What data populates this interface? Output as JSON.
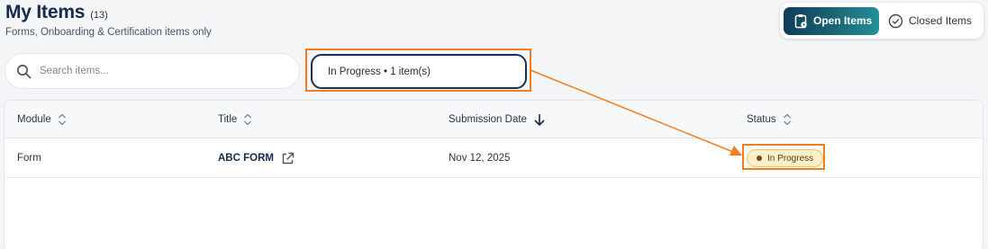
{
  "header": {
    "title": "My Items",
    "count": "(13)",
    "subtitle": "Forms, Onboarding & Certification items only"
  },
  "toggle": {
    "open_label": "Open Items",
    "closed_label": "Closed Items",
    "active": "open"
  },
  "search": {
    "placeholder": "Search items...",
    "value": ""
  },
  "filter": {
    "label": "In Progress • 1 item(s)"
  },
  "table": {
    "columns": [
      {
        "label": "Module",
        "sort": "unsorted"
      },
      {
        "label": "Title",
        "sort": "unsorted"
      },
      {
        "label": "Submission Date",
        "sort": "descending"
      },
      {
        "label": "Status",
        "sort": "unsorted"
      }
    ],
    "rows": [
      {
        "module": "Form",
        "title": "ABC FORM",
        "submission_date": "Nov 12, 2025",
        "status": "In Progress"
      }
    ]
  },
  "colors": {
    "annotation": "#f07d21",
    "brand_dark": "#0f3b5a",
    "brand_teal": "#22909a",
    "status_bg": "#fdf0c8"
  },
  "icons": [
    "search-icon",
    "clipboard-icon",
    "check-circle-icon",
    "sort-icon",
    "sort-down-icon",
    "external-link-icon",
    "status-dot-icon",
    "annotation-arrow"
  ]
}
